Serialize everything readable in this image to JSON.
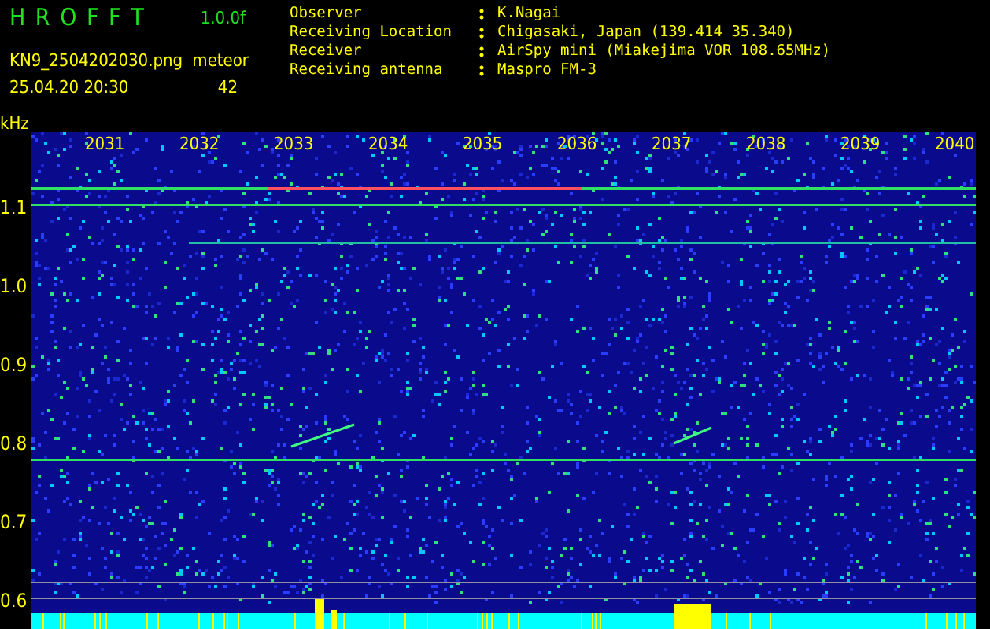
{
  "app": {
    "title": "H R O F F T",
    "version": "1.0.0f",
    "file": "KN9_2504202030.png",
    "datetime": "25.04.20 20:30",
    "counter_label": "meteor",
    "counter_value": "42"
  },
  "info": [
    {
      "label": "Observer",
      "value": "K.Nagai"
    },
    {
      "label": "Receiving Location",
      "value": "Chigasaki, Japan (139.414 35.340)"
    },
    {
      "label": "Receiver",
      "value": "AirSpy mini (Miakejima VOR 108.65MHz)"
    },
    {
      "label": "Receiving antenna",
      "value": "Maspro FM-3"
    }
  ],
  "spectrogram": {
    "unit": "kHz",
    "frequency_labels": [
      "1.1",
      "1.0",
      "0.9",
      "0.8",
      "0.7",
      "0.6"
    ],
    "time_labels": [
      "2031",
      "2032",
      "2033",
      "2034",
      "2035",
      "2036",
      "2037",
      "2038",
      "2039",
      "2040"
    ]
  }
}
